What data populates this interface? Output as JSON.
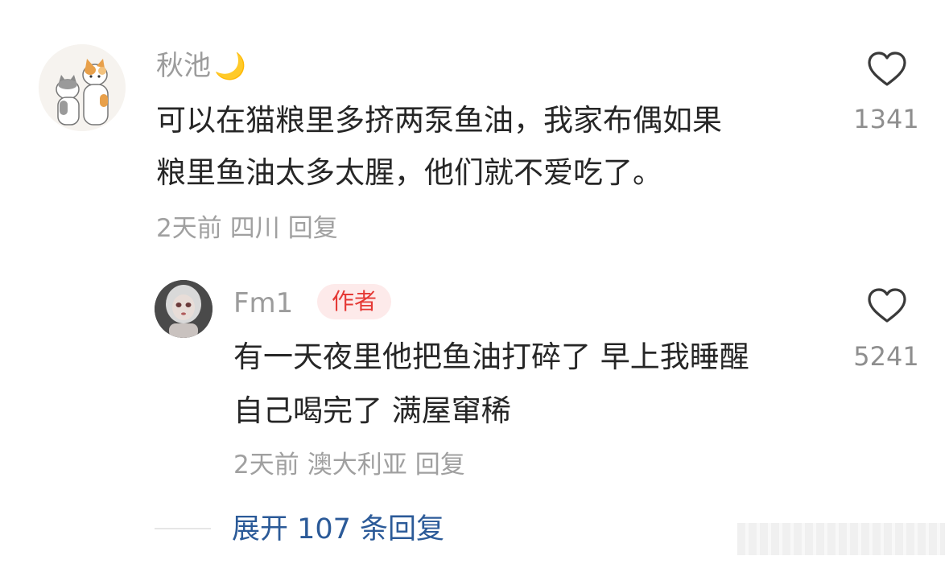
{
  "comment": {
    "username": "秋池",
    "username_emoji": "🌙",
    "text_lines": [
      "可以在猫粮里多挤两泵鱼油，我家布偶如果",
      "粮里鱼油太多太腥，他们就不爱吃了。"
    ],
    "time": "2天前",
    "location": "四川",
    "reply_label": "回复",
    "like_count": "1341",
    "avatar_icon": "cats-avatar"
  },
  "reply": {
    "username": "Fm1",
    "badge": "作者",
    "text_lines": [
      "有一天夜里他把鱼油打碎了 早上我睡醒",
      "自己喝完了 满屋窜稀"
    ],
    "time": "2天前",
    "location": "澳大利亚",
    "reply_label": "回复",
    "like_count": "5241",
    "avatar_icon": "doll-avatar"
  },
  "expand": {
    "label": "展开 107 条回复"
  },
  "colors": {
    "username": "#9c9c9c",
    "text": "#262626",
    "meta": "#a0a0a0",
    "badge_bg": "#fdeaea",
    "badge_text": "#e53935",
    "link": "#2b5a98"
  }
}
